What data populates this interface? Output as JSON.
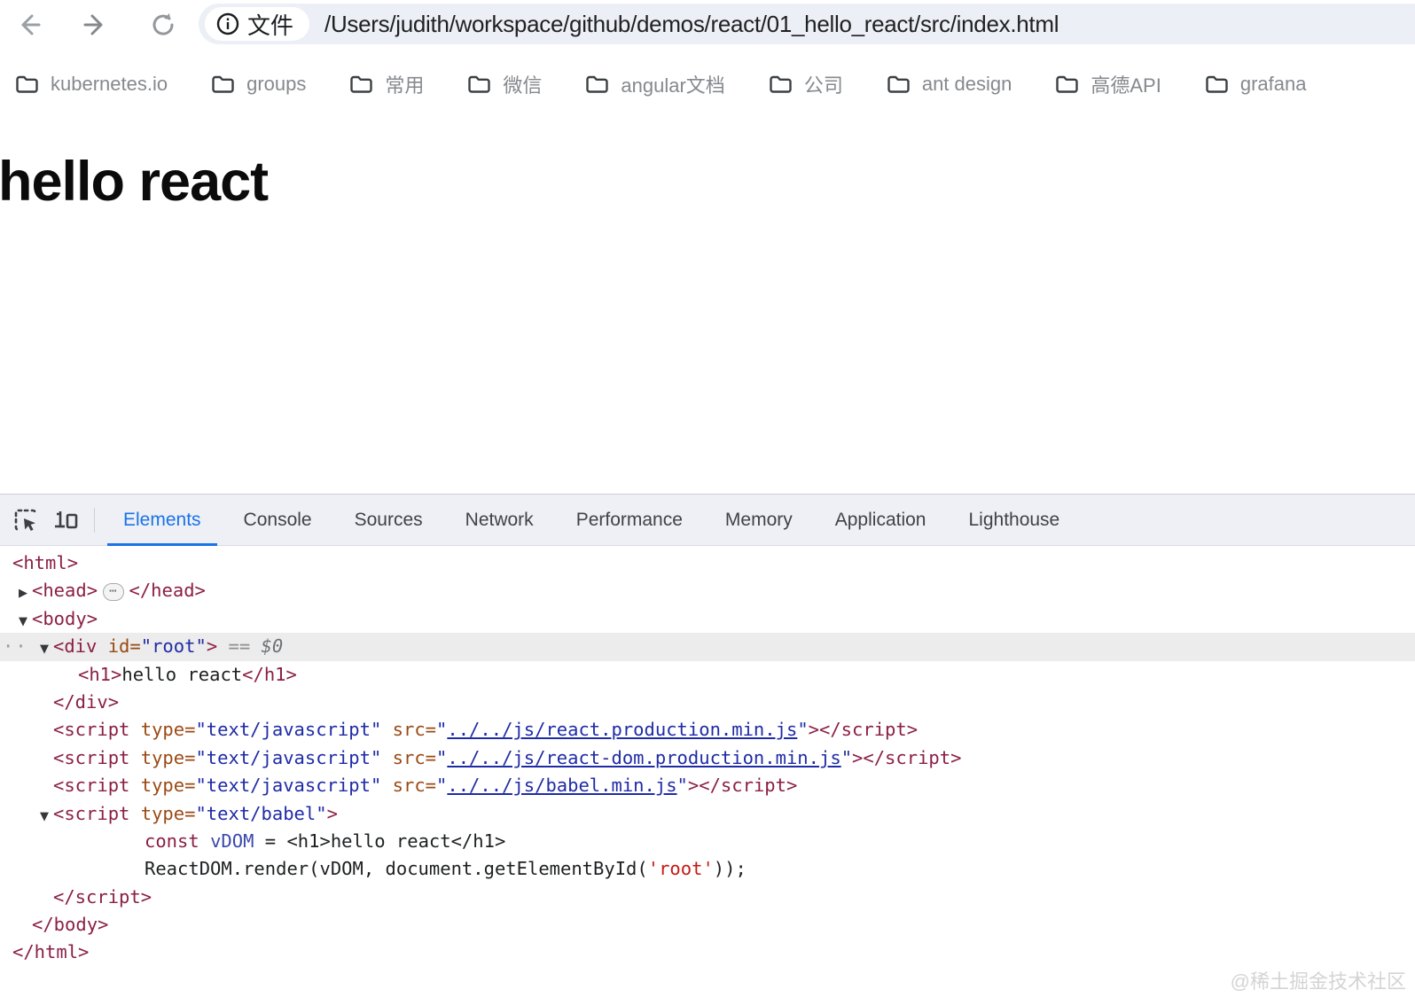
{
  "browser": {
    "nav": [
      {
        "name": "back-icon",
        "color": "#9aa0a6"
      },
      {
        "name": "forward-icon",
        "color": "#85898e"
      },
      {
        "name": "reload-icon",
        "color": "#94989c"
      }
    ],
    "scheme_chip": "文件",
    "url": "/Users/judith/workspace/github/demos/react/01_hello_react/src/index.html"
  },
  "bookmarks": [
    "kubernetes.io",
    "groups",
    "常用",
    "微信",
    "angular文档",
    "公司",
    "ant design",
    "高德API",
    "grafana"
  ],
  "page": {
    "heading": "hello react"
  },
  "devtools": {
    "active_tab": "Elements",
    "tabs": [
      "Elements",
      "Console",
      "Sources",
      "Network",
      "Performance",
      "Memory",
      "Application",
      "Lighthouse"
    ],
    "accent_color": "#1a73e8",
    "tree": [
      {
        "indent": 0,
        "tokens": [
          [
            "tag",
            "<html>"
          ]
        ]
      },
      {
        "indent": 1,
        "arrow": "right",
        "tokens": [
          [
            "tag",
            "<head>"
          ],
          [
            "pill",
            "⋯"
          ],
          [
            "tag",
            "</head>"
          ]
        ]
      },
      {
        "indent": 1,
        "arrow": "down",
        "tokens": [
          [
            "tag",
            "<body>"
          ]
        ]
      },
      {
        "indent": 2,
        "arrow": "down",
        "selected": true,
        "gutter": "··",
        "tokens": [
          [
            "tag",
            "<div"
          ],
          [
            "text",
            " "
          ],
          [
            "attr",
            "id="
          ],
          [
            "value",
            "\"root\""
          ],
          [
            "tag",
            ">"
          ],
          [
            "muted",
            " == "
          ],
          [
            "mutedItalic",
            "$0"
          ]
        ]
      },
      {
        "indent": 3,
        "tokens": [
          [
            "tag",
            "<h1>"
          ],
          [
            "text",
            "hello react"
          ],
          [
            "tag",
            "</h1>"
          ]
        ]
      },
      {
        "indent": 2,
        "tokens": [
          [
            "tag",
            "</div>"
          ]
        ]
      },
      {
        "indent": 2,
        "tokens": [
          [
            "tag",
            "<script"
          ],
          [
            "text",
            " "
          ],
          [
            "attr",
            "type="
          ],
          [
            "value",
            "\"text/javascript\""
          ],
          [
            "text",
            " "
          ],
          [
            "attr",
            "src="
          ],
          [
            "value",
            "\""
          ],
          [
            "link",
            "../../js/react.production.min.js"
          ],
          [
            "value",
            "\""
          ],
          [
            "tag",
            "></script>"
          ]
        ]
      },
      {
        "indent": 2,
        "tokens": [
          [
            "tag",
            "<script"
          ],
          [
            "text",
            " "
          ],
          [
            "attr",
            "type="
          ],
          [
            "value",
            "\"text/javascript\""
          ],
          [
            "text",
            " "
          ],
          [
            "attr",
            "src="
          ],
          [
            "value",
            "\""
          ],
          [
            "link",
            "../../js/react-dom.production.min.js"
          ],
          [
            "value",
            "\""
          ],
          [
            "tag",
            "></script>"
          ]
        ]
      },
      {
        "indent": 2,
        "tokens": [
          [
            "tag",
            "<script"
          ],
          [
            "text",
            " "
          ],
          [
            "attr",
            "type="
          ],
          [
            "value",
            "\"text/javascript\""
          ],
          [
            "text",
            " "
          ],
          [
            "attr",
            "src="
          ],
          [
            "value",
            "\""
          ],
          [
            "link",
            "../../js/babel.min.js"
          ],
          [
            "value",
            "\""
          ],
          [
            "tag",
            "></script>"
          ]
        ]
      },
      {
        "indent": 2,
        "arrow": "down",
        "tokens": [
          [
            "tag",
            "<script"
          ],
          [
            "text",
            " "
          ],
          [
            "attr",
            "type="
          ],
          [
            "value",
            "\"text/babel\""
          ],
          [
            "tag",
            ">"
          ]
        ]
      },
      {
        "indent": 5,
        "tokens": [
          [
            "keyword",
            "const"
          ],
          [
            "text",
            " "
          ],
          [
            "var",
            "vDOM"
          ],
          [
            "text",
            " = <h1>hello react</h1>"
          ]
        ]
      },
      {
        "indent": 5,
        "tokens": [
          [
            "text",
            "ReactDOM.render(vDOM, document.getElementById("
          ],
          [
            "string",
            "'root'"
          ],
          [
            "text",
            "));"
          ]
        ]
      },
      {
        "indent": 2,
        "tokens": [
          [
            "tag",
            "</script>"
          ]
        ]
      },
      {
        "indent": 1,
        "tokens": [
          [
            "tag",
            "</body>"
          ]
        ]
      },
      {
        "indent": 0,
        "tokens": [
          [
            "tag",
            "</html>"
          ]
        ]
      }
    ]
  },
  "watermark": "@稀土掘金技术社区"
}
